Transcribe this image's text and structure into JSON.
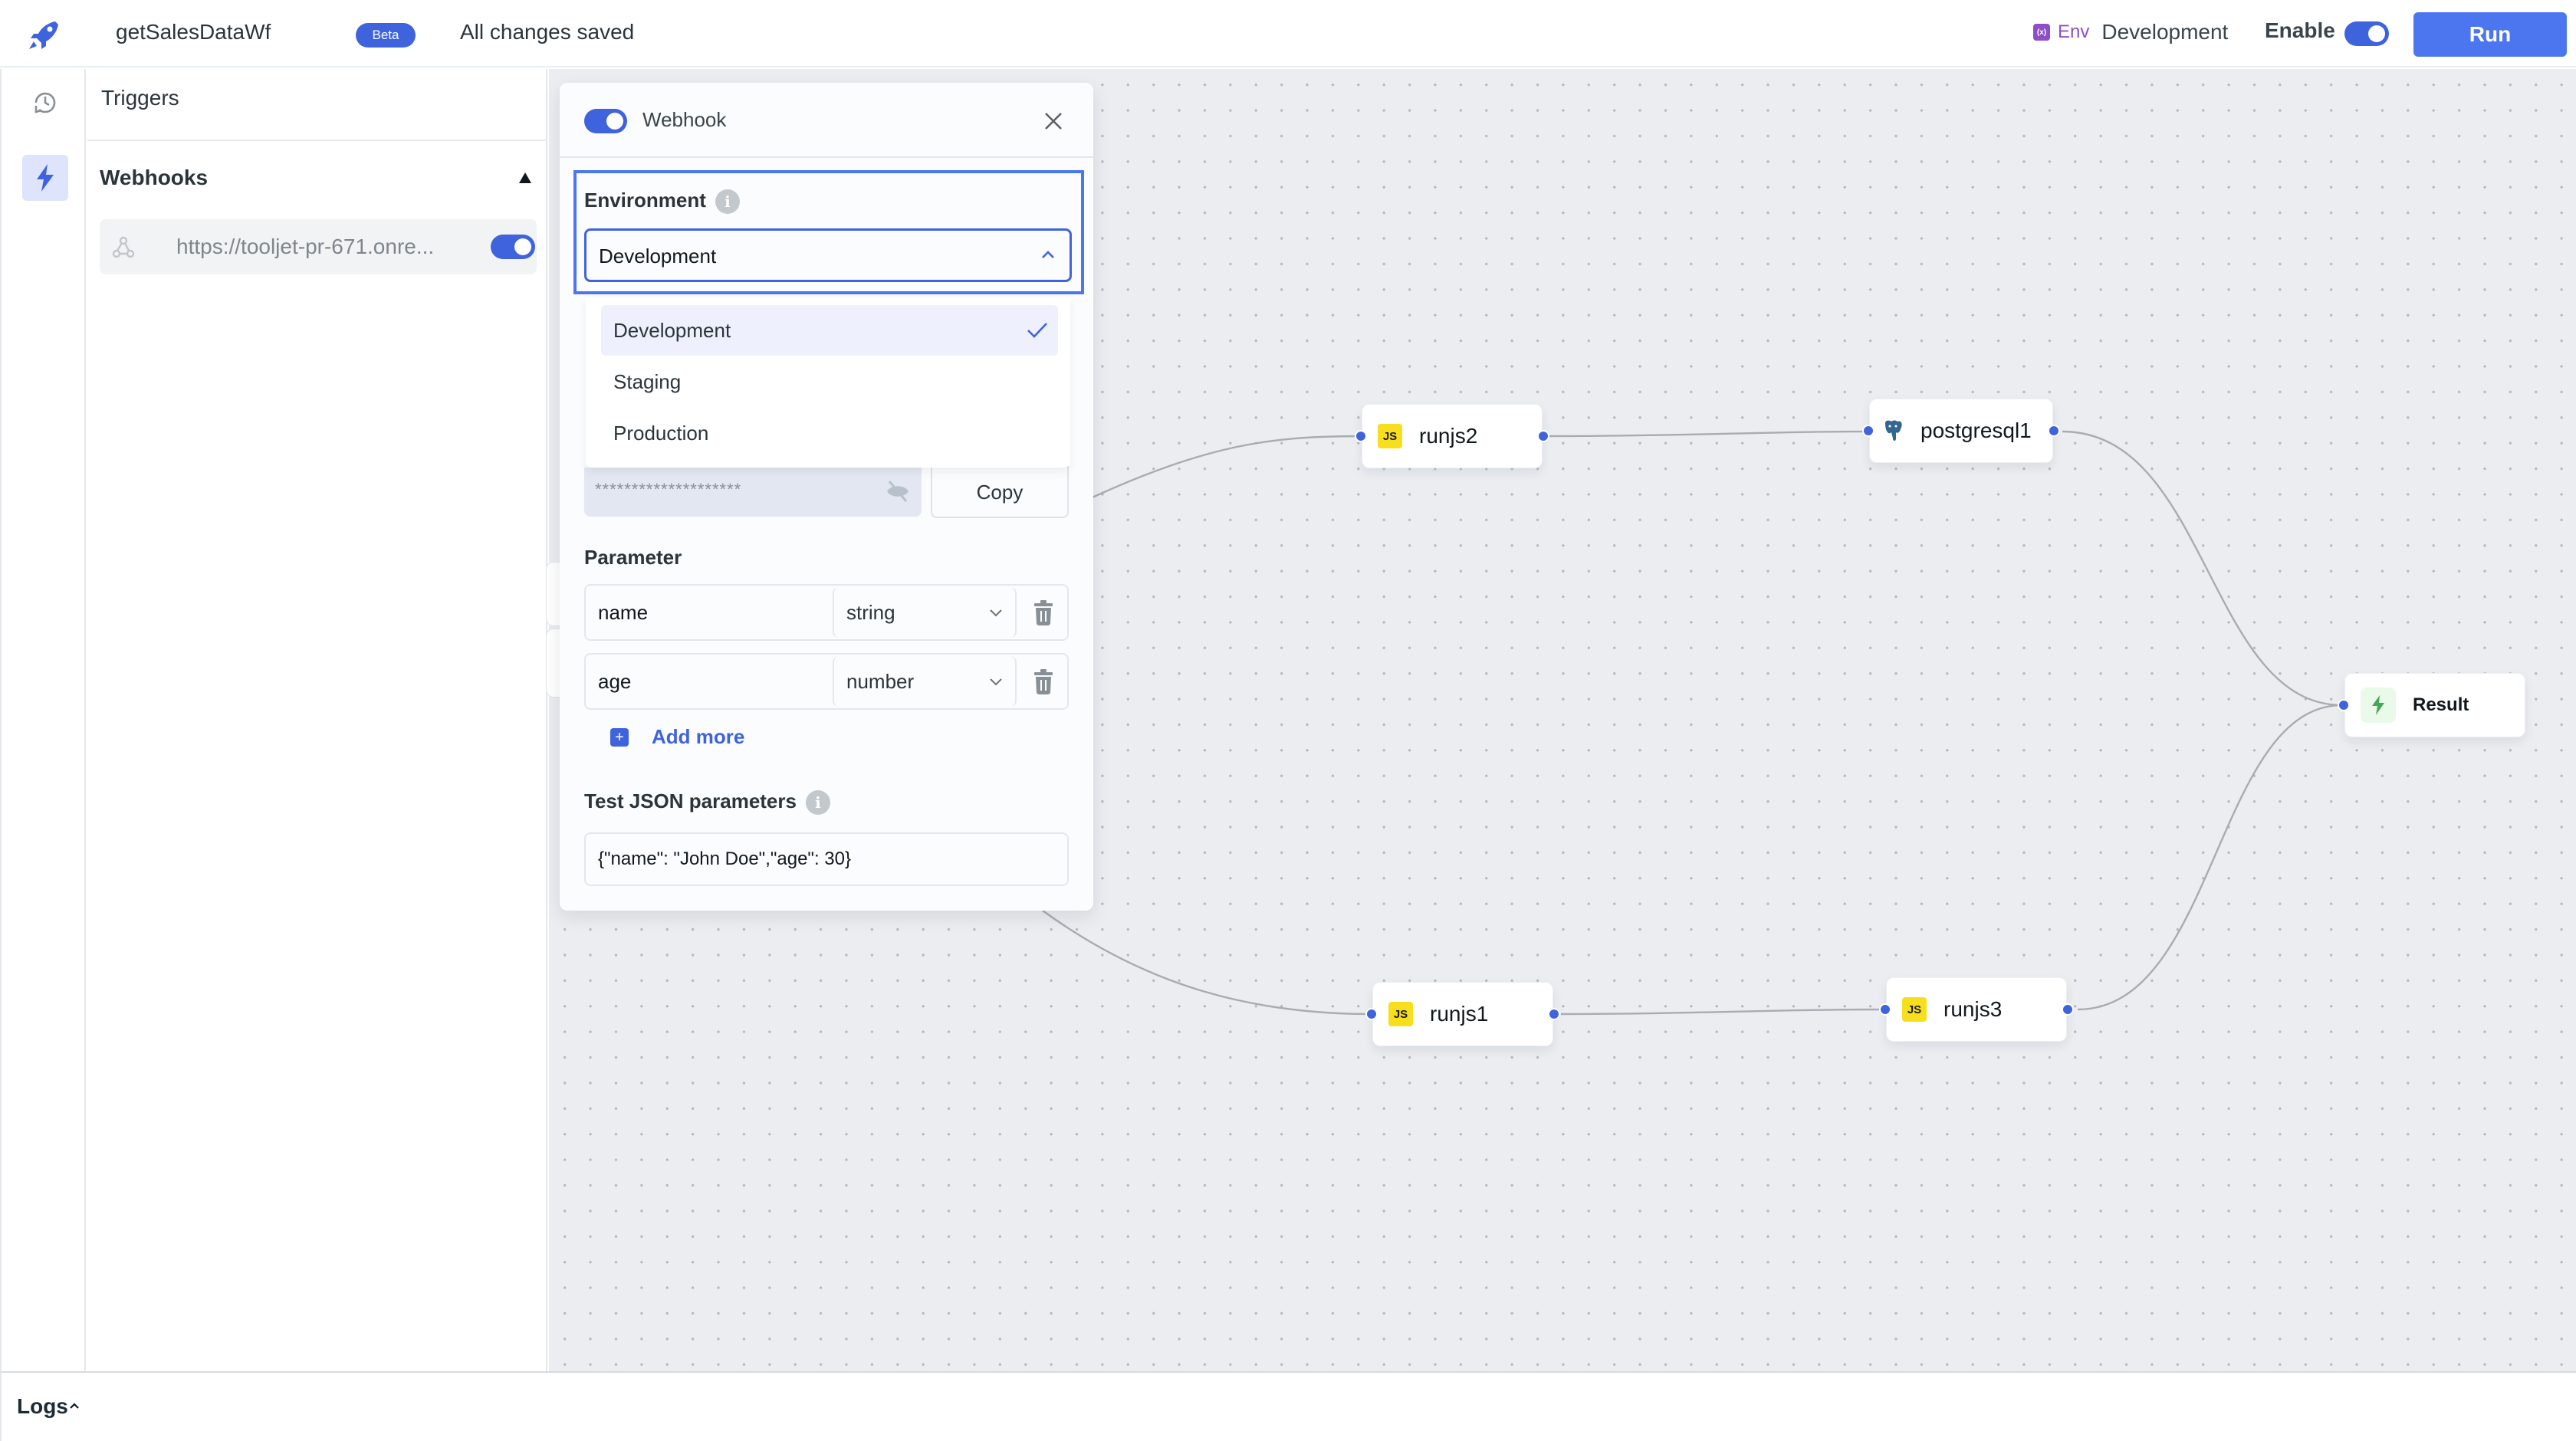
{
  "header": {
    "app_name": "getSalesDataWf",
    "badge": "Beta",
    "save_status": "All changes saved",
    "env_label": "Env",
    "env_value": "Development",
    "enable_label": "Enable",
    "enabled": true,
    "run_label": "Run",
    "accent": "#3e63dd"
  },
  "rail": {
    "items": [
      {
        "icon": "history-icon",
        "active": false
      },
      {
        "icon": "lightning-icon",
        "active": true
      }
    ]
  },
  "triggers": {
    "title": "Triggers",
    "section_title": "Webhooks",
    "webhooks": [
      {
        "url": "https://tooljet-pr-671.onre...",
        "enabled": true
      }
    ]
  },
  "webhook_panel": {
    "title": "Webhook",
    "enabled": true,
    "environment_label": "Environment",
    "environment_value": "Development",
    "environment_options": [
      {
        "label": "Development",
        "selected": true
      },
      {
        "label": "Staging",
        "selected": false
      },
      {
        "label": "Production",
        "selected": false
      }
    ],
    "secret_masked": "********************",
    "copy_label": "Copy",
    "parameter_label": "Parameter",
    "parameters": [
      {
        "name": "name",
        "type": "string"
      },
      {
        "name": "age",
        "type": "number"
      }
    ],
    "add_more_label": "Add more",
    "test_json_label": "Test JSON parameters",
    "test_json_value": "{\"name\": \"John Doe\",\"age\": 30}"
  },
  "canvas": {
    "nodes": [
      {
        "id": "runjs2",
        "label": "runjs2",
        "kind": "js"
      },
      {
        "id": "postgresql1",
        "label": "postgresql1",
        "kind": "postgres"
      },
      {
        "id": "result",
        "label": "Result",
        "kind": "result"
      },
      {
        "id": "runjs1",
        "label": "runjs1",
        "kind": "js"
      },
      {
        "id": "runjs3",
        "label": "runjs3",
        "kind": "js"
      }
    ],
    "edges": [
      {
        "from": "start",
        "to": "runjs2"
      },
      {
        "from": "start",
        "to": "runjs1"
      },
      {
        "from": "runjs2",
        "to": "postgresql1"
      },
      {
        "from": "runjs1",
        "to": "runjs3"
      },
      {
        "from": "postgresql1",
        "to": "result"
      },
      {
        "from": "runjs3",
        "to": "result"
      }
    ],
    "js_badge": "JS"
  },
  "logs": {
    "label": "Logs"
  }
}
